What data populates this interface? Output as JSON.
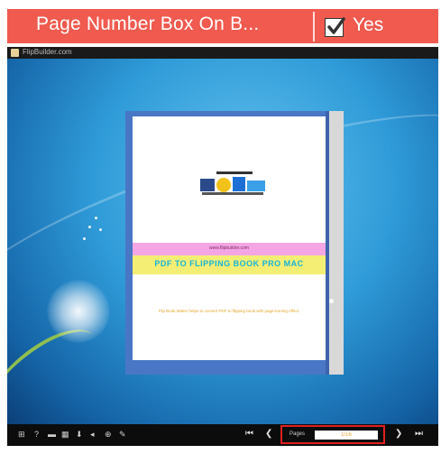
{
  "banner": {
    "title": "Page Number Box On B...",
    "checkbox_checked": true,
    "option_label": "Yes",
    "color": "#f05a4f"
  },
  "window": {
    "title": "FlipBuilder.com"
  },
  "book": {
    "url_text": "www.flipbuilder.com",
    "heading": "PDF TO FLIPPING BOOK PRO MAC",
    "description": "Flip Book Maker helps to convert PDF to flipping book with page-turning effect.",
    "logo": "flipbuilder-logo-icon"
  },
  "toolbar": {
    "icons": [
      "thumbnails-icon",
      "help-icon",
      "print-icon",
      "table-of-contents-icon",
      "download-icon",
      "sound-icon",
      "zoom-icon",
      "share-icon"
    ],
    "pages_label": "Pages",
    "page_value": "1/16",
    "first_label": "⏮",
    "prev_label": "❮",
    "next_label": "❯",
    "last_label": "⏭"
  }
}
